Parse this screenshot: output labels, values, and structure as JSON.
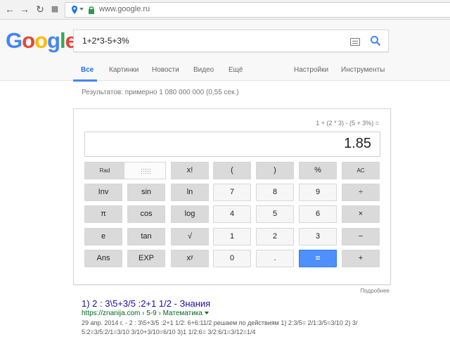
{
  "browser": {
    "url": "www.google.ru",
    "icons": [
      "back-icon",
      "forward-icon",
      "reload-icon",
      "apps-icon",
      "location-pin-icon",
      "dropdown-icon",
      "lock-icon"
    ]
  },
  "logo": {
    "text": "Google",
    "colors": [
      "#4285f4",
      "#ea4335",
      "#fbbc05",
      "#4285f4",
      "#34a853",
      "#ea4335"
    ]
  },
  "search": {
    "query": "1+2*3-5+3%"
  },
  "tabs": [
    {
      "label": "Все",
      "active": true
    },
    {
      "label": "Картинки"
    },
    {
      "label": "Новости"
    },
    {
      "label": "Видео"
    },
    {
      "label": "Ещё"
    },
    {
      "label": "Настройки"
    },
    {
      "label": "Инструменты"
    }
  ],
  "results_stats": "Результатов: примерно 1 080 000 000 (0,55 сек.)",
  "calculator": {
    "expression": "1 + (2 * 3) - (5 + 3%) =",
    "display": "1.85",
    "rad_label": "Rad",
    "keys": {
      "fact": "x!",
      "lparen": "(",
      "rparen": ")",
      "percent": "%",
      "ac": "AC",
      "inv": "Inv",
      "sin": "sin",
      "ln": "ln",
      "n7": "7",
      "n8": "8",
      "n9": "9",
      "div": "÷",
      "pi": "π",
      "cos": "cos",
      "log": "log",
      "n4": "4",
      "n5": "5",
      "n6": "6",
      "mul": "×",
      "e": "e",
      "tan": "tan",
      "sqrt": "√",
      "n1": "1",
      "n2": "2",
      "n3": "3",
      "sub": "−",
      "ans": "Ans",
      "exp": "EXP",
      "pow": "xʸ",
      "n0": "0",
      "dot": ".",
      "eq": "=",
      "add": "+"
    },
    "more_link": "Подробнее"
  },
  "result": {
    "title": "1) 2 : 3\\5+3/5 :2+1 1/2 - Знания",
    "url": "https://znanija.com › 5-9 › Математика",
    "snippet_line1": "29 апр. 2014 г. - 2 : 3\\5+3/5 :2+1 1/2: 6+6:11/2 решаем по действиям 1) 2:3/5= 2/1:3/5=3/10 2) 3/",
    "snippet_line2": "5:2=3/5:2/1=3/10 3/10+3/10=6/10 3)1 1/2:6= 3/2:6/1=3/12=1/4"
  }
}
